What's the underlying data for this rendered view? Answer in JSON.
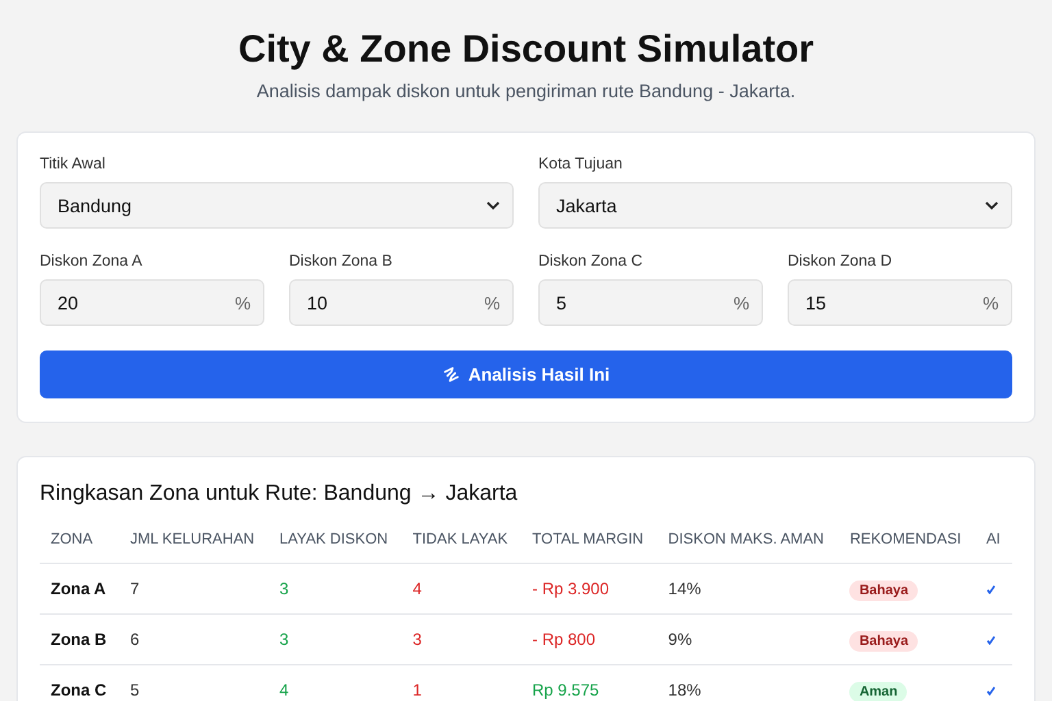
{
  "header": {
    "title": "City & Zone Discount Simulator",
    "subtitle": "Analisis dampak diskon untuk pengiriman rute Bandung - Jakarta."
  },
  "form": {
    "selects": [
      {
        "label": "Titik Awal",
        "value": "Bandung"
      },
      {
        "label": "Kota Tujuan",
        "value": "Jakarta"
      }
    ],
    "discounts": [
      {
        "label": "Diskon Zona A",
        "value": "20",
        "unit": "%"
      },
      {
        "label": "Diskon Zona B",
        "value": "10",
        "unit": "%"
      },
      {
        "label": "Diskon Zona C",
        "value": "5",
        "unit": "%"
      },
      {
        "label": "Diskon Zona D",
        "value": "15",
        "unit": "%"
      }
    ],
    "button": "Analisis Hasil Ini"
  },
  "summary": {
    "title": "Ringkasan Zona untuk Rute: Bandung → Jakarta",
    "columns": [
      "ZONA",
      "JML KELURAHAN",
      "LAYAK DISKON",
      "TIDAK LAYAK",
      "TOTAL MARGIN",
      "DISKON MAKS. AMAN",
      "REKOMENDASI",
      "AI"
    ],
    "rows": [
      {
        "zone": "Zona A",
        "count": "7",
        "eligible": "3",
        "ineligible": "4",
        "margin": {
          "text": "- Rp 3.900",
          "kind": "negative"
        },
        "max_safe": "14%",
        "recommendation": {
          "text": "Bahaya",
          "kind": "danger"
        }
      },
      {
        "zone": "Zona B",
        "count": "6",
        "eligible": "3",
        "ineligible": "3",
        "margin": {
          "text": "- Rp 800",
          "kind": "negative"
        },
        "max_safe": "9%",
        "recommendation": {
          "text": "Bahaya",
          "kind": "danger"
        }
      },
      {
        "zone": "Zona C",
        "count": "5",
        "eligible": "4",
        "ineligible": "1",
        "margin": {
          "text": "Rp 9.575",
          "kind": "positive"
        },
        "max_safe": "18%",
        "recommendation": {
          "text": "Aman",
          "kind": "safe"
        }
      }
    ]
  }
}
